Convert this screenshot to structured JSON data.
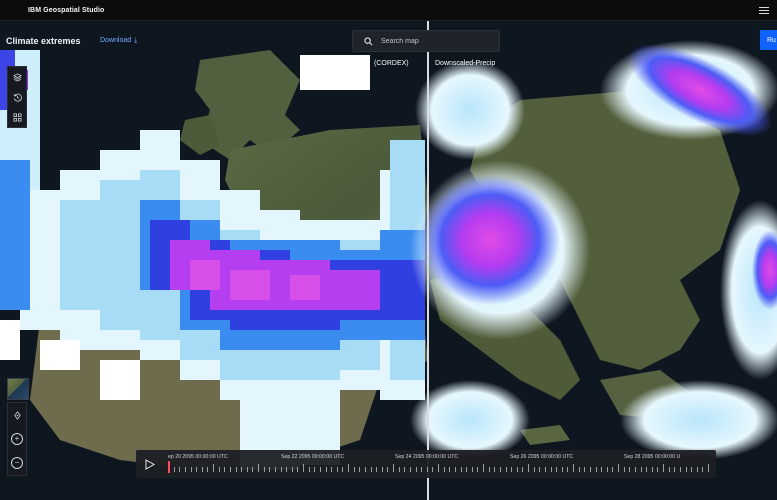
{
  "app": {
    "brand": "IBM Geospatial Studio"
  },
  "header": {
    "title": "Climate extremes",
    "download_label": "Download",
    "search_placeholder": "Search map",
    "run_label": "Ru"
  },
  "map": {
    "layer_left": "(CORDEX)",
    "layer_right": "Downscaled-Precip",
    "precip_colors": {
      "low": "#d8f3fb",
      "mid": "#3a8cf0",
      "high": "#3d2ae0",
      "extreme": "#c23cf0"
    }
  },
  "toolbar": {
    "top": [
      {
        "icon": "layers-icon"
      },
      {
        "icon": "history-icon"
      },
      {
        "icon": "compare-icon"
      }
    ],
    "bottom": [
      {
        "icon": "locate-icon"
      },
      {
        "icon": "zoom-in-icon"
      },
      {
        "icon": "zoom-out-icon"
      }
    ]
  },
  "timeline": {
    "labels": [
      "ep 20 2095 00:00:00 UTC",
      "Sep 22 2095 00:00:00 UTC",
      "Sep 24 2095 00:00:00 UTC",
      "Sep 26 2095 00:00:00 UTC",
      "Sep 28 2095 00:00:00 U"
    ]
  }
}
